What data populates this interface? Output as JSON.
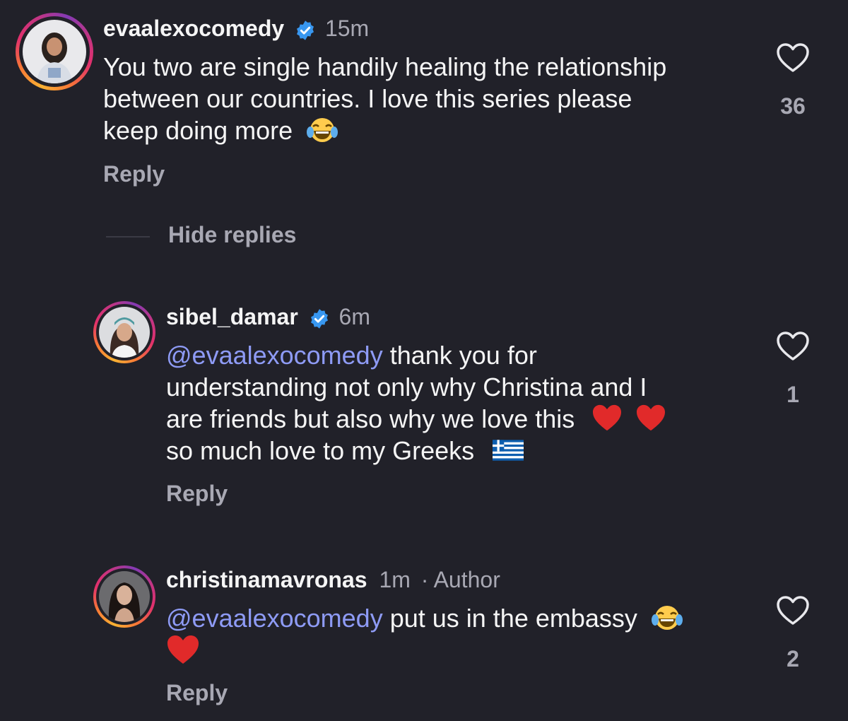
{
  "comments": [
    {
      "username": "evaalexocomedy",
      "time": "15m",
      "text_parts": [
        "You two are single handily healing the relationship",
        "between our countries. I love this series please",
        "keep doing more"
      ],
      "reply_label": "Reply",
      "likes": "36",
      "verified": true
    },
    {
      "username": "sibel_damar",
      "time": "6m",
      "mention": "@evaalexocomedy",
      "line1_rest": " thank you for",
      "line2": "understanding not only why Christina and I",
      "line3": "are friends but also why we love this",
      "line4": "so much love to my Greeks",
      "reply_label": "Reply",
      "likes": "1",
      "verified": true
    },
    {
      "username": "christinamavronas",
      "time": "1m",
      "author_label": "· Author",
      "mention": "@evaalexocomedy",
      "text_rest": " put us in the embassy",
      "reply_label": "Reply",
      "likes": "2"
    }
  ],
  "hide_replies_label": "Hide replies",
  "colors": {
    "background": "#212129",
    "mention": "#8e9bf5",
    "verified": "#3897f0",
    "muted": "#a8a8b3"
  },
  "icons": [
    "verified-badge-icon",
    "heart-outline-icon",
    "laughing-emoji-icon",
    "red-heart-emoji-icon",
    "greek-flag-emoji-icon"
  ]
}
